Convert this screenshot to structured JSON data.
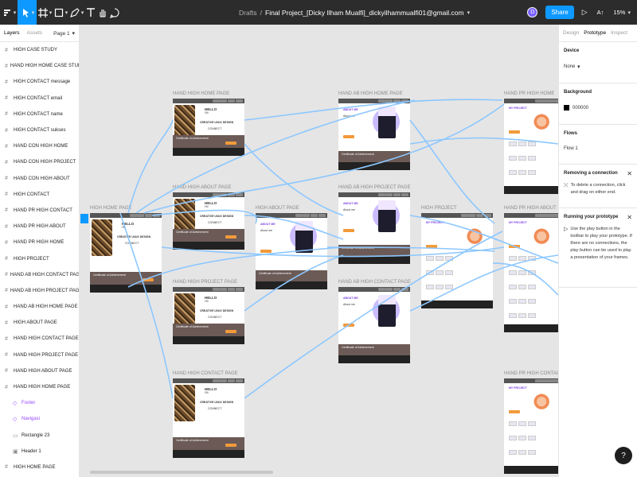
{
  "colors": {
    "toolbar": "#2c2c2c",
    "accent": "#0d99ff",
    "connector": "#8cc7ff",
    "component": "#9747ff",
    "canvas": "#e5e5e5"
  },
  "toolbar": {
    "tools": [
      "main-menu-icon",
      "move-tool-icon",
      "frame-tool-icon",
      "shape-tool-icon",
      "pen-tool-icon",
      "text-tool-icon",
      "hand-tool-icon",
      "comment-tool-icon"
    ],
    "drafts": "Drafts",
    "separator": "/",
    "file_name": "Final Project_[Dicky Ilham Mualfi]_dickyilhammualfi01@gmail.com",
    "avatar": "D",
    "share": "Share",
    "at": "A↑",
    "zoom": "15%"
  },
  "left_panel": {
    "tabs": [
      "Layers",
      "Assets"
    ],
    "page": "Page 1",
    "layers": [
      {
        "name": "HIGH CASE STUDY",
        "type": "frame"
      },
      {
        "name": "HAND HIGH HOME CASE STUDY",
        "type": "frame"
      },
      {
        "name": "HIGH CONTACT message",
        "type": "frame"
      },
      {
        "name": "HIGH CONTACT email",
        "type": "frame"
      },
      {
        "name": "HIGH CONTACT name",
        "type": "frame"
      },
      {
        "name": "HIGH CONTACT sukses",
        "type": "frame"
      },
      {
        "name": "HAND CON HIGH HOME",
        "type": "frame"
      },
      {
        "name": "HAND CON HIGH PROJECT",
        "type": "frame"
      },
      {
        "name": "HAND CON HIGH ABOUT",
        "type": "frame"
      },
      {
        "name": "HIGH CONTACT",
        "type": "frame"
      },
      {
        "name": "HAND PR HIGH CONTACT",
        "type": "frame"
      },
      {
        "name": "HAND PR HIGH ABOUT",
        "type": "frame"
      },
      {
        "name": "HAND PR HIGH HOME",
        "type": "frame"
      },
      {
        "name": "HIGH PROJECT",
        "type": "frame"
      },
      {
        "name": "HAND AB HIGH CONTACT PAGE",
        "type": "frame"
      },
      {
        "name": "HAND AB HIGH PROJECT PAGE",
        "type": "frame"
      },
      {
        "name": "HAND AB HIGH HOME PAGE",
        "type": "frame"
      },
      {
        "name": "HIGH ABOUT PAGE",
        "type": "frame"
      },
      {
        "name": "HAND HIGH CONTACT PAGE",
        "type": "frame"
      },
      {
        "name": "HAND HIGH PROJECT PAGE",
        "type": "frame"
      },
      {
        "name": "HAND HIGH ABOUT PAGE",
        "type": "frame"
      },
      {
        "name": "HAND HIGH HOME PAGE",
        "type": "frame"
      },
      {
        "name": "Footer",
        "type": "component"
      },
      {
        "name": "Navigasi",
        "type": "component"
      },
      {
        "name": "Rectangle 23",
        "type": "rect"
      },
      {
        "name": "Header 1",
        "type": "image"
      },
      {
        "name": "HIGH HOME PAGE",
        "type": "frame"
      }
    ]
  },
  "canvas": {
    "frames": [
      {
        "id": "f1",
        "label": "HAND HIGH HOME PAGE",
        "kind": "home"
      },
      {
        "id": "f2",
        "label": "HAND HIGH ABOUT PAGE",
        "kind": "home"
      },
      {
        "id": "f3",
        "label": "HAND HIGH PROJECT PAGE",
        "kind": "home"
      },
      {
        "id": "f4",
        "label": "HAND HIGH CONTACT PAGE",
        "kind": "home"
      },
      {
        "id": "f5",
        "label": "HIGH HOME PAGE",
        "kind": "home"
      },
      {
        "id": "f6",
        "label": "HIGH ABOUT PAGE",
        "kind": "about"
      },
      {
        "id": "f7",
        "label": "HAND AB HIGH HOME PAGE",
        "kind": "about"
      },
      {
        "id": "f8",
        "label": "HAND AB HIGH PROJECT PAGE",
        "kind": "about"
      },
      {
        "id": "f9",
        "label": "HAND AB HIGH CONTACT PAGE",
        "kind": "about"
      },
      {
        "id": "f10",
        "label": "HIGH PROJECT",
        "kind": "project"
      },
      {
        "id": "f11",
        "label": "HAND PR HIGH HOME",
        "kind": "project"
      },
      {
        "id": "f12",
        "label": "HAND PR HIGH ABOUT",
        "kind": "project"
      },
      {
        "id": "f13",
        "label": "HAND PR HIGH CONTACT",
        "kind": "project"
      }
    ],
    "frame_text": {
      "hello": "HELLO",
      "im": "I'M",
      "tagline": "CREATIVE UI/UX DESIGN",
      "connect": "CONNECT",
      "about_me": "ABOUT ME",
      "my_project": "MY PROJECT",
      "certificate": "Certificate of Achievement",
      "about_heading": "About me"
    }
  },
  "right_panel": {
    "tabs": [
      "Design",
      "Prototype",
      "Inspect"
    ],
    "device_label": "Device",
    "device_value": "None",
    "background_label": "Background",
    "background_value": "000000",
    "flows_label": "Flows",
    "flow_name": "Flow 1",
    "removing_title": "Removing a connection",
    "removing_body": "To delete a connection, click and drag on either end.",
    "running_title": "Running your prototype",
    "running_body": "Use the play button in the toolbar to play your prototype. If there are no connections, the play button can be used to play a presentation of your frames."
  },
  "help": "?"
}
